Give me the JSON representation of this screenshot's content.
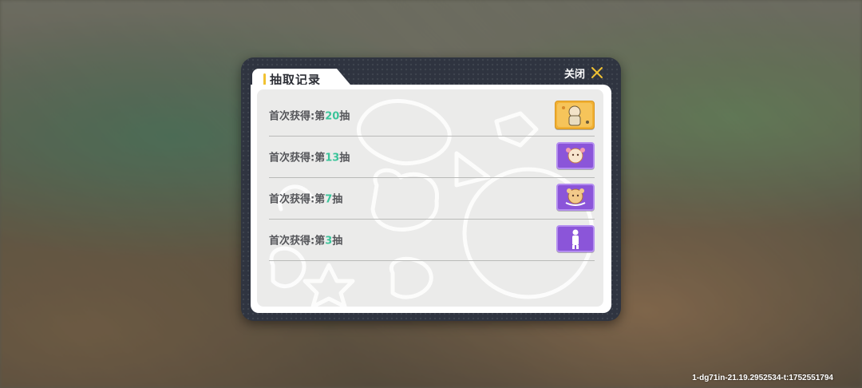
{
  "dialog": {
    "title": "抽取记录",
    "close_label": "关闭",
    "accent_color": "#f1c232",
    "highlight_color": "#3bc49a"
  },
  "records": [
    {
      "prefix": "首次获得:第",
      "number": "20",
      "suffix": "抽",
      "reward_icon": "character-card-gold",
      "rarity_color": "#f2b134"
    },
    {
      "prefix": "首次获得:第",
      "number": "13",
      "suffix": "抽",
      "reward_icon": "sticker-purple",
      "rarity_color": "#8b55d9"
    },
    {
      "prefix": "首次获得:第",
      "number": "7",
      "suffix": "抽",
      "reward_icon": "sticker-purple",
      "rarity_color": "#8b55d9"
    },
    {
      "prefix": "首次获得:第",
      "number": "3",
      "suffix": "抽",
      "reward_icon": "figure-purple",
      "rarity_color": "#8b55d9"
    }
  ],
  "footer": {
    "build_id": "1-dg71in-21.19.2952534-t:1752551794"
  }
}
